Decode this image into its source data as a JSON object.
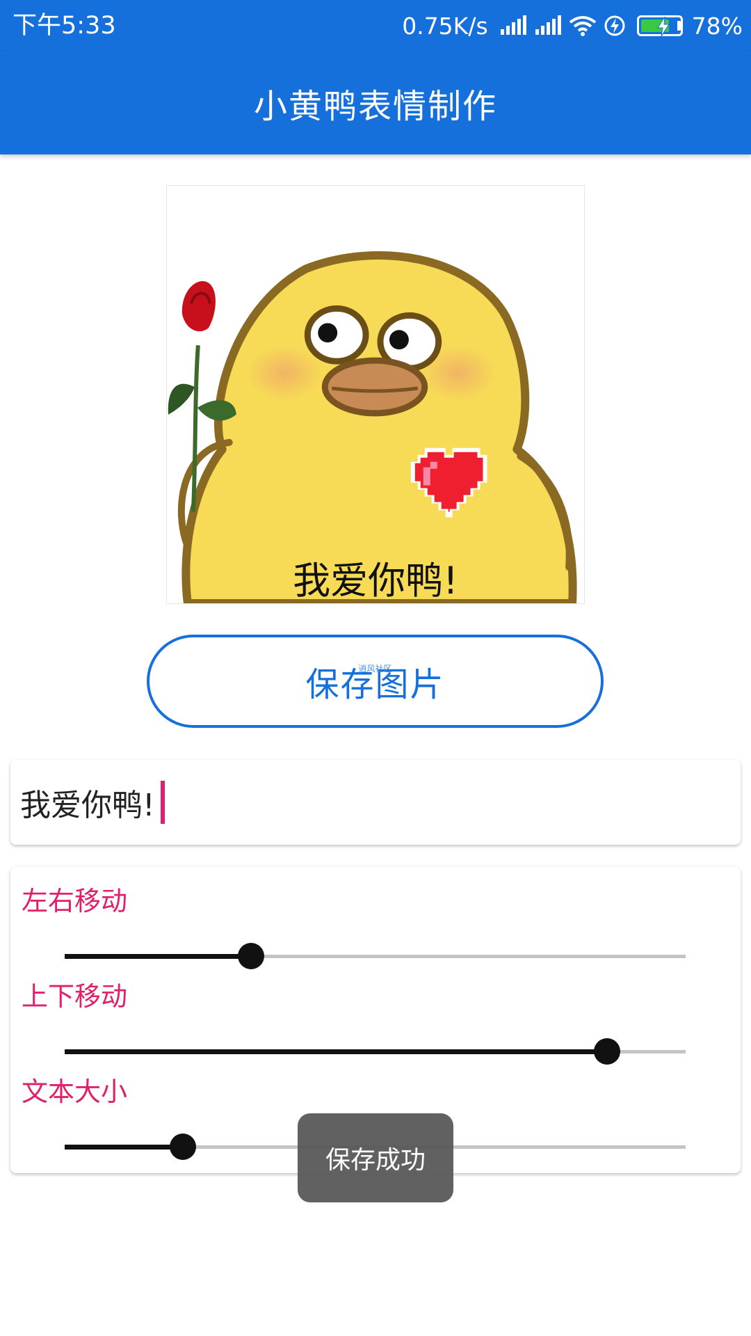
{
  "status_bar": {
    "time": "下午5:33",
    "network_speed": "0.75K/s",
    "battery_percent": "78%",
    "icons": [
      "signal-icon",
      "signal-icon",
      "wifi-icon",
      "charging-icon",
      "battery-icon"
    ]
  },
  "app_bar": {
    "title": "小黄鸭表情制作"
  },
  "preview": {
    "caption": "我爱你鸭!"
  },
  "save_button": {
    "label": "保存图片",
    "watermark": "逍风社区"
  },
  "text_input": {
    "value": "我爱你鸭!"
  },
  "sliders": [
    {
      "label": "左右移动",
      "value": 0.3
    },
    {
      "label": "上下移动",
      "value": 0.873
    },
    {
      "label": "文本大小",
      "value": 0.19
    }
  ],
  "toast": {
    "message": "保存成功"
  },
  "colors": {
    "primary": "#1670db",
    "accent": "#e0206a",
    "toast_bg": "#585858"
  }
}
